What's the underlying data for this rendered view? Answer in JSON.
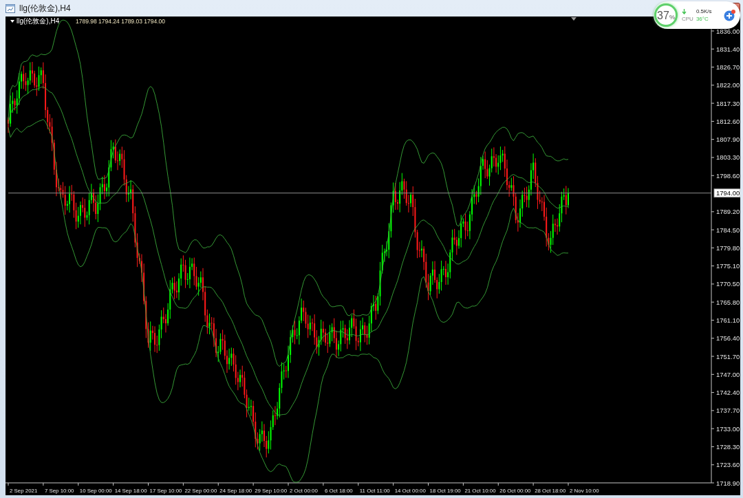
{
  "window": {
    "title": "llg(伦敦金),H4"
  },
  "chart": {
    "symbol": "llg(伦敦金),H4",
    "ohlc": "1789.98 1794.24 1789.03 1794.00",
    "current_price": "1794.00",
    "time_axis_labels": [
      "2 Sep 2021",
      "7 Sep 10:00",
      "10 Sep 00:00",
      "14 Sep 18:00",
      "17 Sep 10:00",
      "22 Sep 00:00",
      "24 Sep 18:00",
      "29 Sep 10:00",
      "2 Oct 00:00",
      "6 Oct 18:00",
      "11 Oct 11:00",
      "14 Oct 00:00",
      "18 Oct 19:00",
      "21 Oct 10:00",
      "26 Oct 00:00",
      "28 Oct 18:00",
      "2 Nov 10:00"
    ],
    "price_axis_labels": [
      "1836.00",
      "1831.40",
      "1826.70",
      "1822.00",
      "1817.30",
      "1812.60",
      "1807.90",
      "1803.30",
      "1798.60",
      "1789.20",
      "1784.50",
      "1779.80",
      "1775.10",
      "1770.50",
      "1765.80",
      "1761.10",
      "1756.40",
      "1751.70",
      "1747.00",
      "1742.40",
      "1737.70",
      "1733.00",
      "1728.30",
      "1723.60",
      "1718.90"
    ]
  },
  "monitor": {
    "percent": "37",
    "percent_sign": "%",
    "speed": "0.5K/s",
    "cpu_label": "CPU",
    "cpu_temp": "36°C"
  }
}
